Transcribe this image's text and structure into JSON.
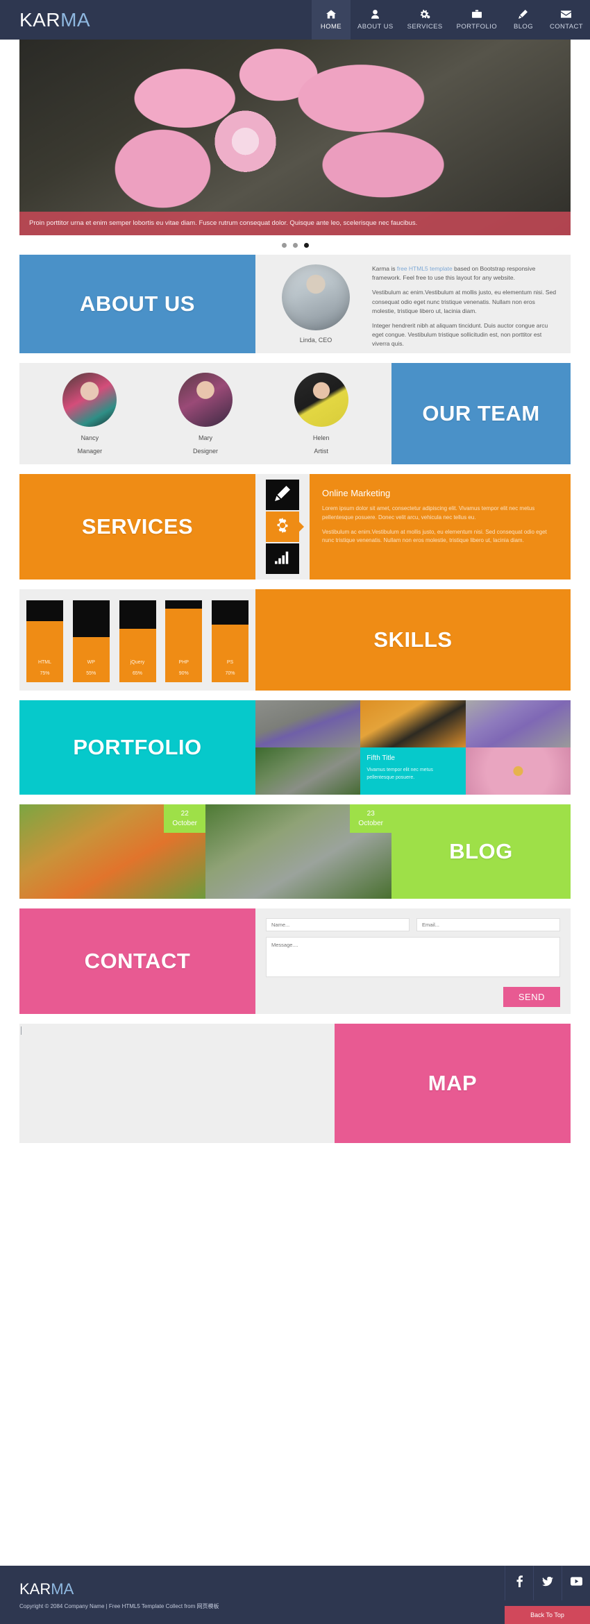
{
  "brand": {
    "part1": "KAR",
    "part2": "MA"
  },
  "nav": {
    "items": [
      {
        "label": "HOME",
        "icon": "home-icon",
        "active": true
      },
      {
        "label": "ABOUT US",
        "icon": "user-icon",
        "active": false
      },
      {
        "label": "SERVICES",
        "icon": "gears-icon",
        "active": false
      },
      {
        "label": "PORTFOLIO",
        "icon": "briefcase-icon",
        "active": false
      },
      {
        "label": "BLOG",
        "icon": "pencil-icon",
        "active": false
      },
      {
        "label": "CONTACT",
        "icon": "envelope-icon",
        "active": false
      }
    ]
  },
  "slider": {
    "caption": "Proin porttitor urna et enim semper lobortis eu vitae diam. Fusce rutrum consequat dolor. Quisque ante leo, scelerisque nec faucibus.",
    "dots": 3,
    "active_dot": 3
  },
  "about": {
    "heading": "ABOUT US",
    "avatar_caption": "Linda, CEO",
    "paragraphs": [
      "Karma is free HTML5 template based on Bootstrap responsive framework. Feel free to use this layout for any website.",
      "Vestibulum ac enim.Vestibulum at mollis justo, eu elementum nisi. Sed consequat odio eget nunc tristique venenatis. Nullam non eros molestie, tristique libero ut, lacinia diam.",
      "Integer hendrerit nibh at aliquam tincidunt. Duis auctor congue arcu eget congue. Vestibulum tristique sollicitudin est, non porttitor est viverra quis."
    ],
    "link_text": "free HTML5 template",
    "para1_before": "Karma is ",
    "para1_after": " based on Bootstrap responsive framework. Feel free to use this layout for any website.",
    "accent": "#4a91c8"
  },
  "team": {
    "heading": "OUR TEAM",
    "accent": "#4a91c8",
    "members": [
      {
        "name": "Nancy",
        "role": "Manager"
      },
      {
        "name": "Mary",
        "role": "Designer"
      },
      {
        "name": "Helen",
        "role": "Artist"
      }
    ]
  },
  "services": {
    "heading": "SERVICES",
    "accent": "#ef8c15",
    "tabs": [
      {
        "icon": "pencil-icon",
        "active": false
      },
      {
        "icon": "gear-icon",
        "active": true
      },
      {
        "icon": "bar-chart-icon",
        "active": false
      }
    ],
    "title": "Online Marketing",
    "paragraphs": [
      "Lorem ipsum dolor sit amet, consectetur adipiscing elit. Vivamus tempor elit nec metus pellentesque posuere. Donec velit arcu, vehicula nec tellus eu.",
      "Vestibulum ac enim.Vestibulum at mollis justo, eu elementum nisi. Sed consequat odio eget nunc tristique venenatis. Nullam non eros molestie, tristique libero ut, lacinia diam."
    ]
  },
  "skills": {
    "heading": "SKILLS",
    "accent": "#ef8c15",
    "chart_data": {
      "type": "bar",
      "title": "SKILLS",
      "categories": [
        "HTML",
        "WP",
        "jQuery",
        "PHP",
        "PS"
      ],
      "values": [
        75,
        55,
        65,
        90,
        70
      ],
      "value_labels": [
        "75%",
        "55%",
        "65%",
        "90%",
        "70%"
      ],
      "ylim": [
        0,
        100
      ],
      "xlabel": "",
      "ylabel": "",
      "grid": false,
      "bar_color": "#ef8c15",
      "track_color": "#0c0c0c"
    }
  },
  "portfolio": {
    "heading": "PORTFOLIO",
    "accent": "#06c9cb",
    "tile_title": "Fifth Title",
    "tile_text": "Vivamus tempor elit nec metus pellentesque posuere."
  },
  "blog": {
    "heading": "BLOG",
    "accent": "#9ee048",
    "posts": [
      {
        "day": "22",
        "month": "October"
      },
      {
        "day": "23",
        "month": "October"
      }
    ]
  },
  "contact": {
    "heading": "CONTACT",
    "accent": "#e85a92",
    "name_placeholder": "Name...",
    "email_placeholder": "Email...",
    "message_placeholder": "Message....",
    "name_value": "",
    "email_value": "",
    "message_value": "",
    "send_label": "SEND"
  },
  "map": {
    "heading": "MAP",
    "accent": "#e85a92"
  },
  "footer": {
    "copyright": "Copyright © 2084 Company Name | Free HTML5 Template Collect from 网页模板",
    "socials": [
      {
        "name": "facebook-icon"
      },
      {
        "name": "twitter-icon"
      },
      {
        "name": "youtube-icon"
      }
    ],
    "back_to_top": "Back To Top",
    "back_to_top_color": "#d1485b"
  }
}
